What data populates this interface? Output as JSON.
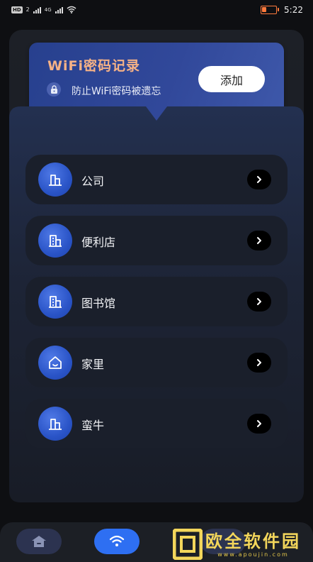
{
  "status_bar": {
    "hd": "HD",
    "hd_sim": "2",
    "network": "4G",
    "time": "5:22",
    "battery_level": 0.35
  },
  "banner": {
    "title": "WiFi密码记录",
    "subtitle": "防止WiFi密码被遗忘",
    "add_label": "添加"
  },
  "locations": [
    {
      "label": "公司",
      "icon": "building-icon"
    },
    {
      "label": "便利店",
      "icon": "store-icon"
    },
    {
      "label": "图书馆",
      "icon": "library-icon"
    },
    {
      "label": "家里",
      "icon": "home-icon"
    },
    {
      "label": "蛮牛",
      "icon": "building-icon"
    }
  ],
  "bottom_nav": {
    "items": [
      {
        "icon": "home-icon",
        "active": false
      },
      {
        "icon": "wifi-icon",
        "active": true
      },
      {
        "icon": "tab-icon",
        "active": false
      }
    ]
  },
  "watermark": {
    "text": "欧全软件园",
    "url": "www.apoujin.com"
  },
  "colors": {
    "background": "#0e0f12",
    "banner_title": "#f6b286",
    "accent_blue": "#2e6ff2",
    "item_bg": "#1a1f2b"
  }
}
